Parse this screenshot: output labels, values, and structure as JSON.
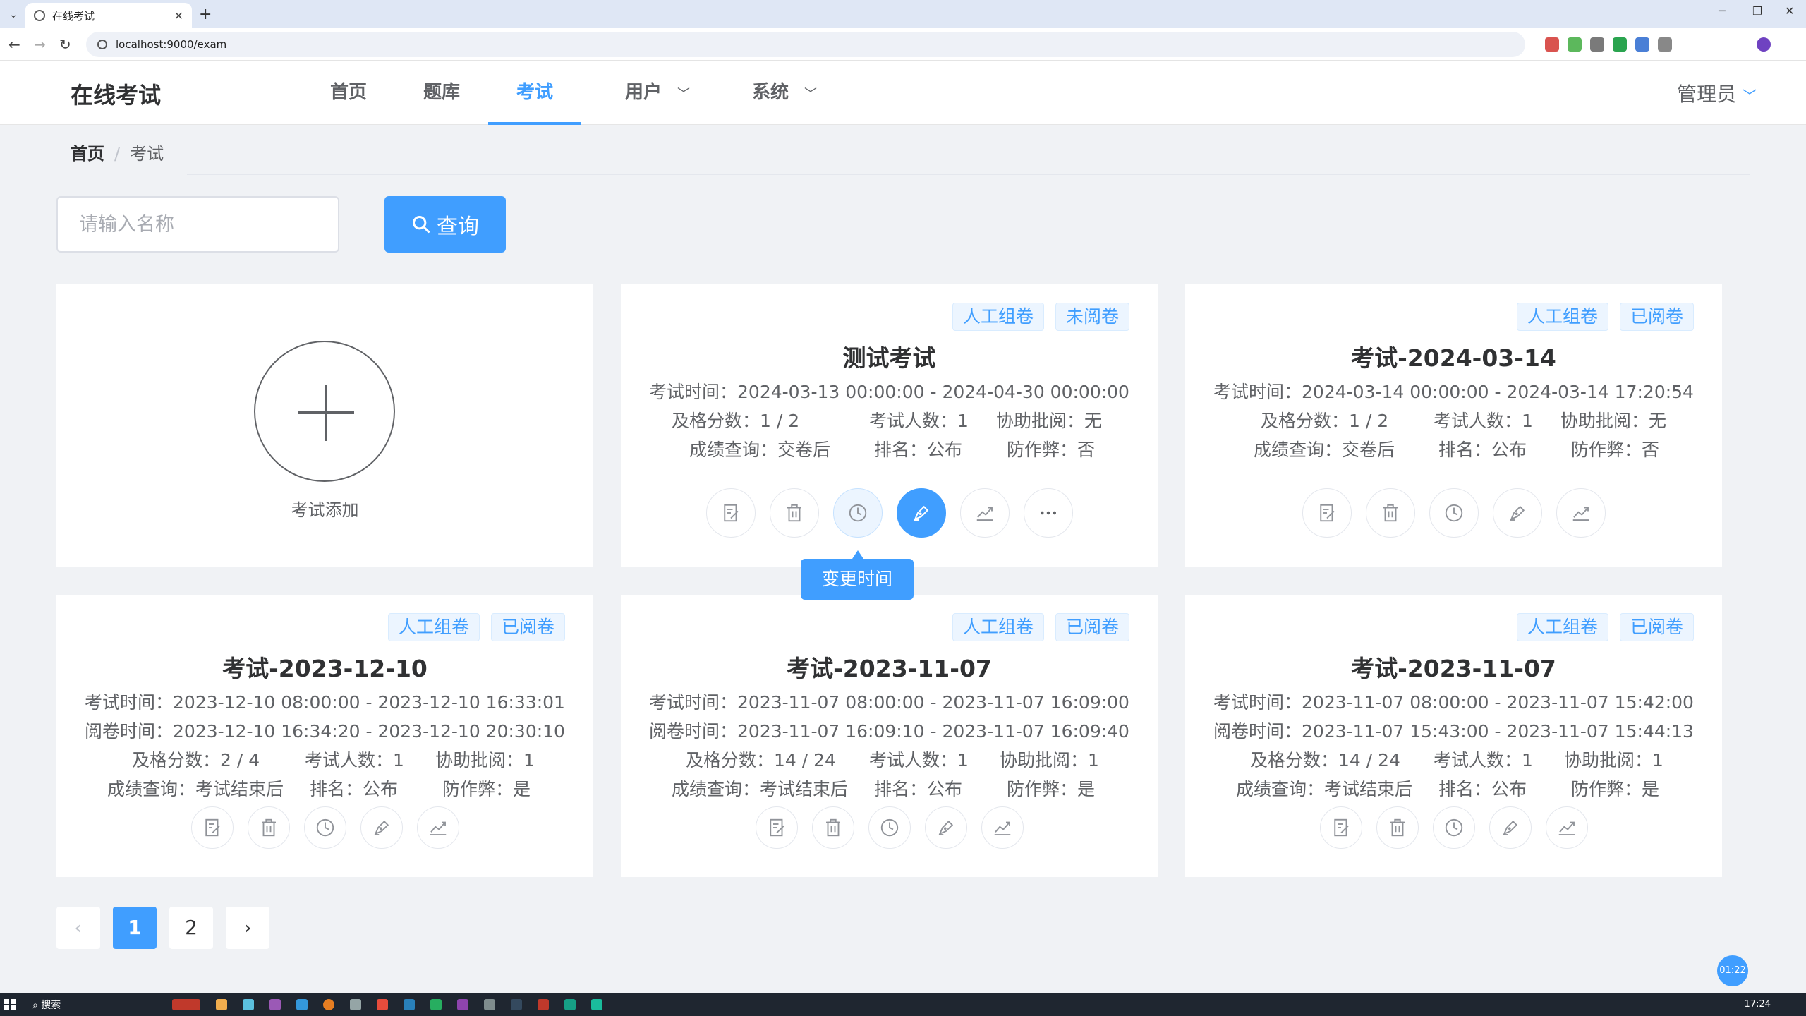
{
  "browser": {
    "tab_title": "在线考试",
    "url": "localhost:9000/exam"
  },
  "header": {
    "logo": "在线考试",
    "nav": [
      "首页",
      "题库",
      "考试",
      "用户",
      "系统"
    ],
    "active": "考试",
    "user": "管理员"
  },
  "breadcrumb": {
    "home": "首页",
    "sep": "/",
    "current": "考试"
  },
  "search": {
    "placeholder": "请输入名称",
    "button": "查询"
  },
  "add_card": {
    "label": "考试添加"
  },
  "cards": [
    {
      "title": "测试考试",
      "tags": [
        "人工组卷",
        "未阅卷"
      ],
      "exam_time": "考试时间：2024-03-13 00:00:00 - 2024-04-30 00:00:00",
      "pass": "及格分数：1 / 2",
      "count": "考试人数：1",
      "assist": "协助批阅：无",
      "query": "成绩查询：交卷后",
      "rank": "排名：公布",
      "anticheat": "防作弊：否"
    },
    {
      "title": "考试-2024-03-14",
      "tags": [
        "人工组卷",
        "已阅卷"
      ],
      "exam_time": "考试时间：2024-03-14 00:00:00 - 2024-03-14 17:20:54",
      "pass": "及格分数：1 / 2",
      "count": "考试人数：1",
      "assist": "协助批阅：无",
      "query": "成绩查询：交卷后",
      "rank": "排名：公布",
      "anticheat": "防作弊：否"
    },
    {
      "title": "考试-2023-12-10",
      "tags": [
        "人工组卷",
        "已阅卷"
      ],
      "exam_time": "考试时间：2023-12-10 08:00:00 - 2023-12-10 16:33:01",
      "mark_time": "阅卷时间：2023-12-10 16:34:20 - 2023-12-10 20:30:10",
      "pass": "及格分数：2 / 4",
      "count": "考试人数：1",
      "assist": "协助批阅：1",
      "query": "成绩查询：考试结束后",
      "rank": "排名：公布",
      "anticheat": "防作弊：是"
    },
    {
      "title": "考试-2023-11-07",
      "tags": [
        "人工组卷",
        "已阅卷"
      ],
      "exam_time": "考试时间：2023-11-07 08:00:00 - 2023-11-07 16:09:00",
      "mark_time": "阅卷时间：2023-11-07 16:09:10 - 2023-11-07 16:09:40",
      "pass": "及格分数：14 / 24",
      "count": "考试人数：1",
      "assist": "协助批阅：1",
      "query": "成绩查询：考试结束后",
      "rank": "排名：公布",
      "anticheat": "防作弊：是"
    },
    {
      "title": "考试-2023-11-07",
      "tags": [
        "人工组卷",
        "已阅卷"
      ],
      "exam_time": "考试时间：2023-11-07 08:00:00 - 2023-11-07 15:42:00",
      "mark_time": "阅卷时间：2023-11-07 15:43:00 - 2023-11-07 15:44:13",
      "pass": "及格分数：14 / 24",
      "count": "考试人数：1",
      "assist": "协助批阅：1",
      "query": "成绩查询：考试结束后",
      "rank": "排名：公布",
      "anticheat": "防作弊：是"
    }
  ],
  "tooltip": "变更时间",
  "pagination": {
    "pages": [
      "1",
      "2"
    ],
    "current": "1"
  },
  "timer": "01:22",
  "taskbar": {
    "search": "搜索",
    "clock": "17:24"
  },
  "colors": {
    "primary": "#409eff",
    "tag_bg": "#ecf5ff"
  }
}
